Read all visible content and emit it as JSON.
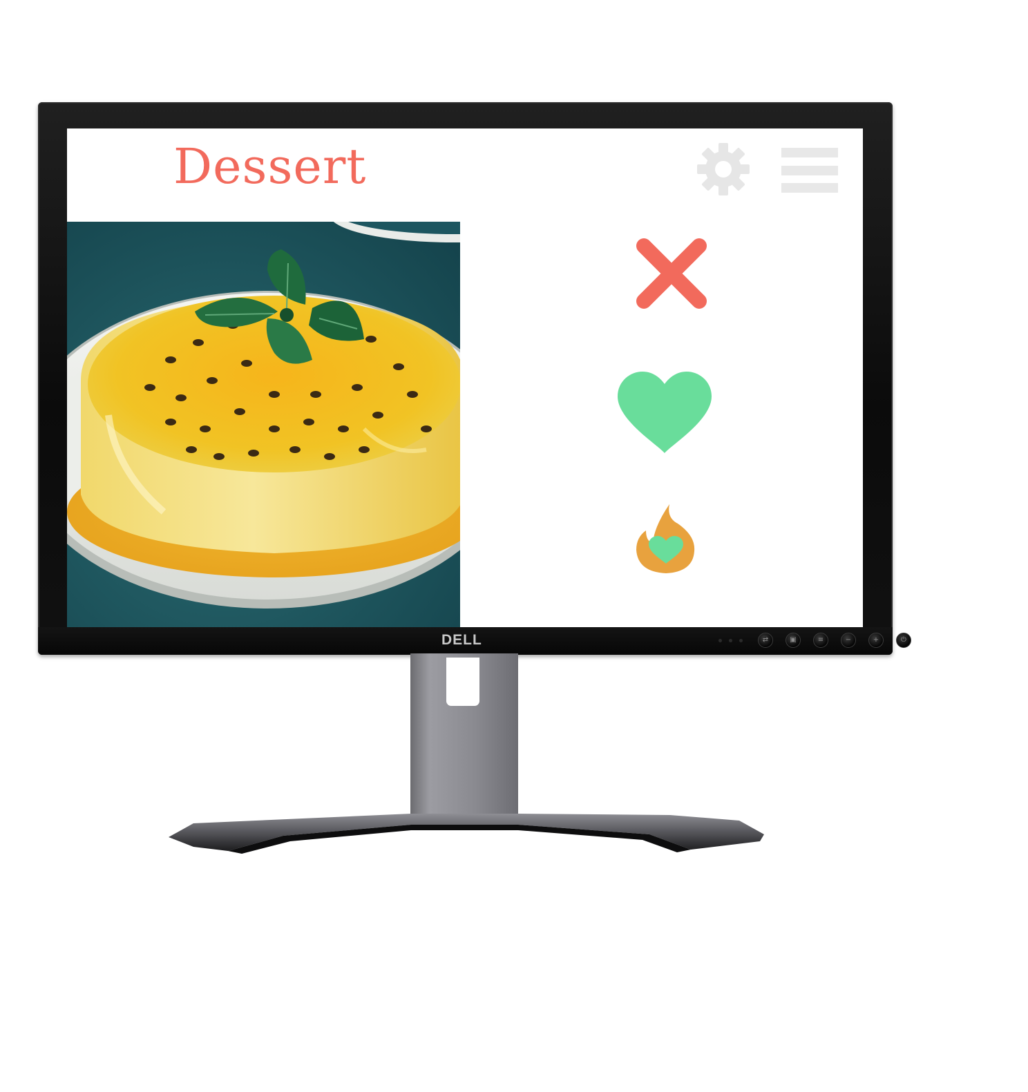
{
  "monitor": {
    "brand": "DELL",
    "controls": [
      "input",
      "menu",
      "toggle",
      "minus",
      "plus",
      "power"
    ]
  },
  "app": {
    "title": "Dessert",
    "title_color": "#f26a5c",
    "header_icons": [
      "gear-icon",
      "hamburger-menu-icon"
    ],
    "card": {
      "image": "passion fruit panna cotta with mint on a plate"
    },
    "actions": [
      {
        "name": "dislike",
        "icon": "close-x-icon",
        "color": "#f26a5c"
      },
      {
        "name": "like",
        "icon": "heart-icon",
        "color": "#69dd9b"
      },
      {
        "name": "super-like",
        "icon": "flame-heart-icon",
        "color": "#e8a23e"
      }
    ]
  }
}
